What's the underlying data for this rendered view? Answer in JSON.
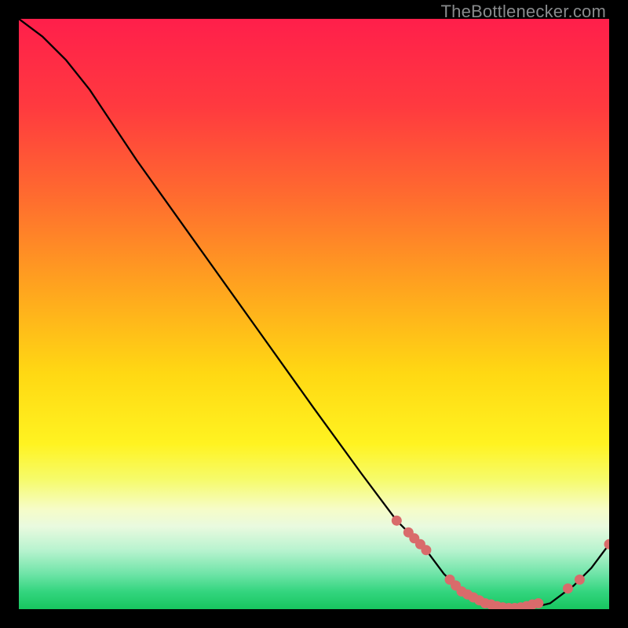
{
  "watermark": "TheBottlenecker.com",
  "chart_data": {
    "type": "line",
    "title": "",
    "xlabel": "",
    "ylabel": "",
    "xlim": [
      0,
      100
    ],
    "ylim": [
      0,
      100
    ],
    "series": [
      {
        "name": "curve",
        "x": [
          0,
          4,
          8,
          12,
          20,
          30,
          40,
          50,
          58,
          64,
          69,
          72,
          75,
          78,
          82,
          86,
          90,
          94,
          97,
          100
        ],
        "y": [
          100,
          97,
          93,
          88,
          76,
          62,
          48,
          34,
          23,
          15,
          10,
          6,
          3,
          1,
          0,
          0,
          1,
          4,
          7,
          11
        ]
      }
    ],
    "markers": {
      "name": "points",
      "x": [
        64,
        66,
        67,
        68,
        69,
        73,
        74,
        75,
        76,
        77,
        78,
        79,
        80,
        81,
        82,
        83,
        84,
        85,
        86,
        87,
        88,
        93,
        95,
        100
      ],
      "y": [
        15,
        13,
        12,
        11,
        10,
        5,
        4,
        3,
        2.5,
        2,
        1.5,
        1,
        0.8,
        0.5,
        0.3,
        0.2,
        0.2,
        0.3,
        0.5,
        0.8,
        1,
        3.5,
        5,
        11
      ]
    },
    "gradient_stops": [
      {
        "offset": 0.0,
        "color": "#ff1f4b"
      },
      {
        "offset": 0.15,
        "color": "#ff3a3f"
      },
      {
        "offset": 0.3,
        "color": "#ff6b2f"
      },
      {
        "offset": 0.45,
        "color": "#ffa21f"
      },
      {
        "offset": 0.6,
        "color": "#ffd813"
      },
      {
        "offset": 0.72,
        "color": "#fff321"
      },
      {
        "offset": 0.78,
        "color": "#f6fb6a"
      },
      {
        "offset": 0.83,
        "color": "#f6fcc7"
      },
      {
        "offset": 0.86,
        "color": "#e9fadf"
      },
      {
        "offset": 0.9,
        "color": "#b8f3cf"
      },
      {
        "offset": 0.94,
        "color": "#6fe4a8"
      },
      {
        "offset": 0.97,
        "color": "#34d57f"
      },
      {
        "offset": 1.0,
        "color": "#17c65f"
      }
    ]
  }
}
